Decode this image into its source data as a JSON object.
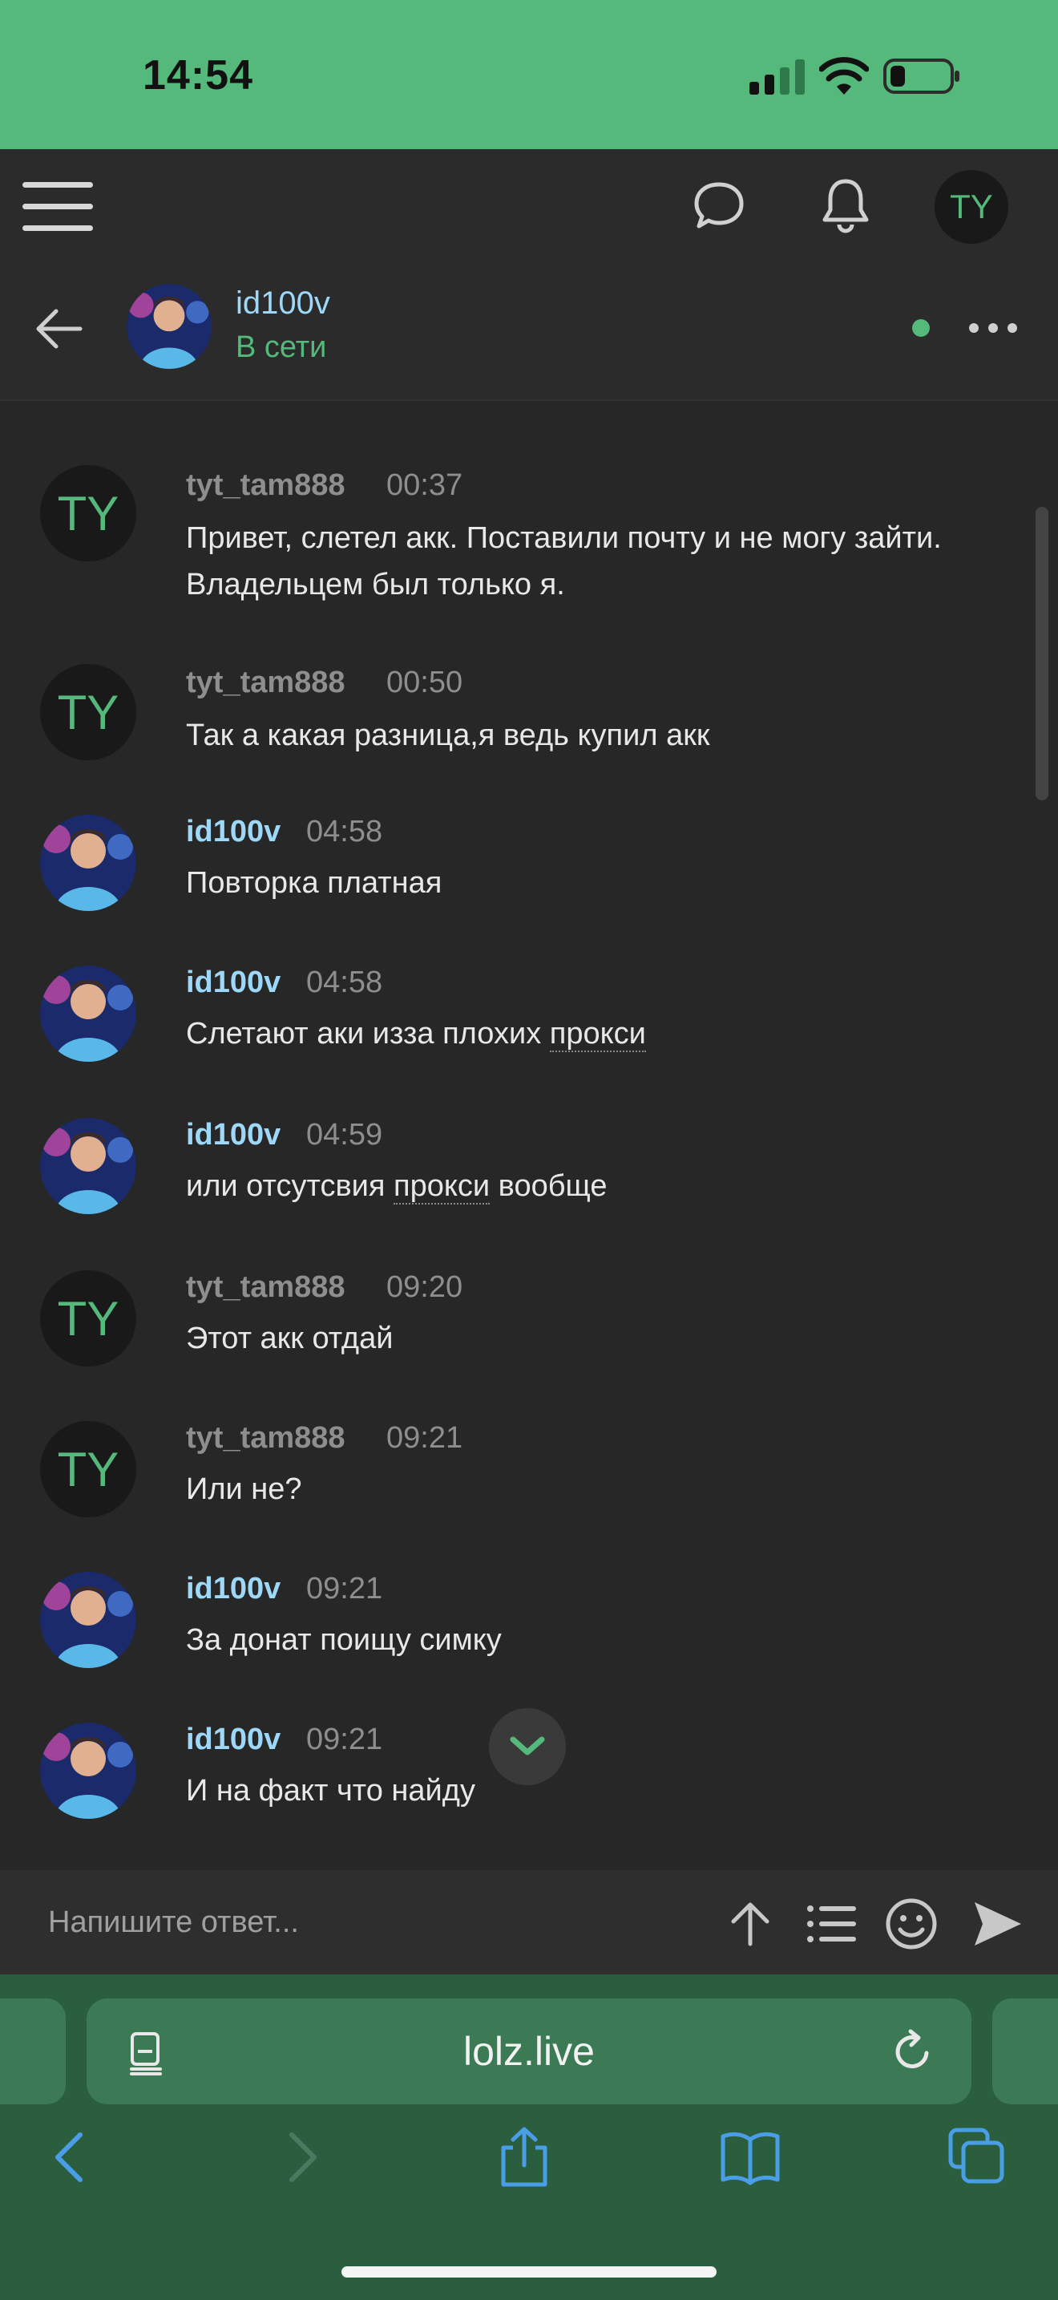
{
  "status_bar": {
    "time": "14:54"
  },
  "top_bar": {
    "user_initials": "TY"
  },
  "conversation": {
    "name": "id100v",
    "status": "В сети"
  },
  "messages": [
    {
      "author": "tyt_tam888",
      "time": "00:37",
      "avatar": "TY",
      "text": "Привет, слетел акк. Поставили почту и не могу зайти. Владельцем был только я."
    },
    {
      "author": "tyt_tam888",
      "time": "00:50",
      "avatar": "TY",
      "text": "Так а какая разница,я ведь купил акк"
    },
    {
      "author": "id100v",
      "time": "04:58",
      "text": "Повторка платная"
    },
    {
      "author": "id100v",
      "time": "04:58",
      "text_before": "Слетают аки изза плохих ",
      "text_link": "прокси",
      "text_after": ""
    },
    {
      "author": "id100v",
      "time": "04:59",
      "text_before": "или отсутсвия ",
      "text_link": "прокси",
      "text_after": " вообще"
    },
    {
      "author": "tyt_tam888",
      "time": "09:20",
      "avatar": "TY",
      "text": "Этот акк отдай"
    },
    {
      "author": "tyt_tam888",
      "time": "09:21",
      "avatar": "TY",
      "text": "Или не?"
    },
    {
      "author": "id100v",
      "time": "09:21",
      "text": "За донат поищу симку"
    },
    {
      "author": "id100v",
      "time": "09:21",
      "text": "И на факт что найду"
    }
  ],
  "reply": {
    "placeholder": "Напишите ответ..."
  },
  "browser": {
    "url": "lolz.live"
  },
  "colors": {
    "accent": "#54b97a",
    "name_blue": "#9ed8f8",
    "background": "#272727"
  }
}
